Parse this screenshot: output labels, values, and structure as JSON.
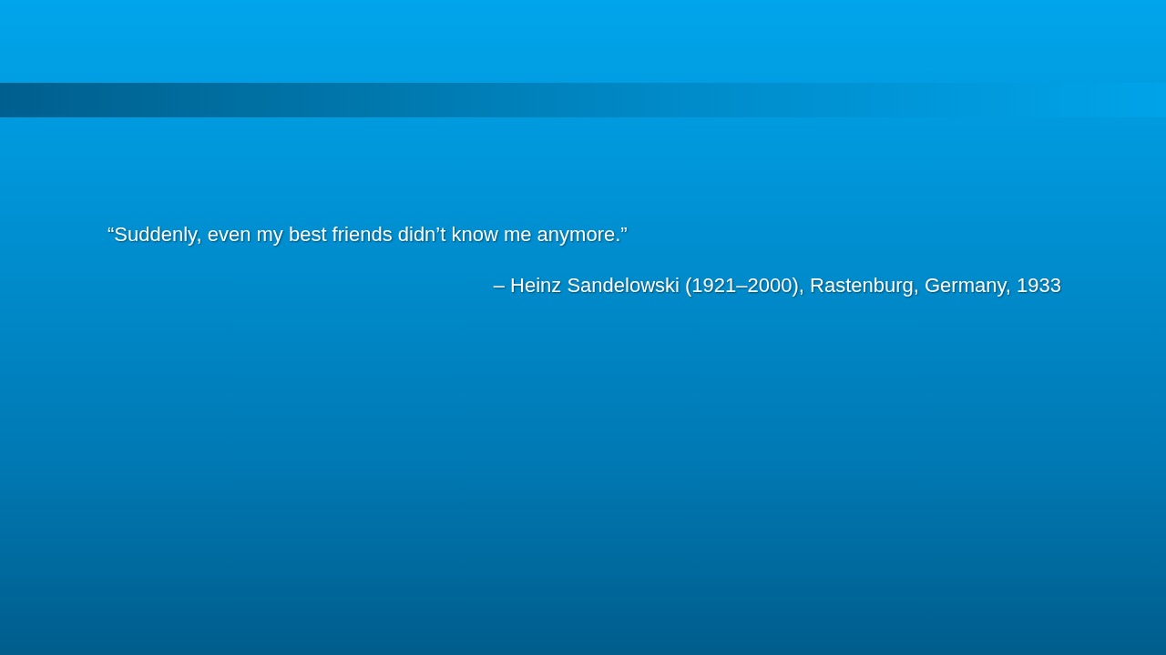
{
  "quote": {
    "text": "“Suddenly, even my best friends didn’t know me anymore.”",
    "attribution": "– Heinz Sandelowski (1921–2000), Rastenburg, Germany, 1933"
  }
}
